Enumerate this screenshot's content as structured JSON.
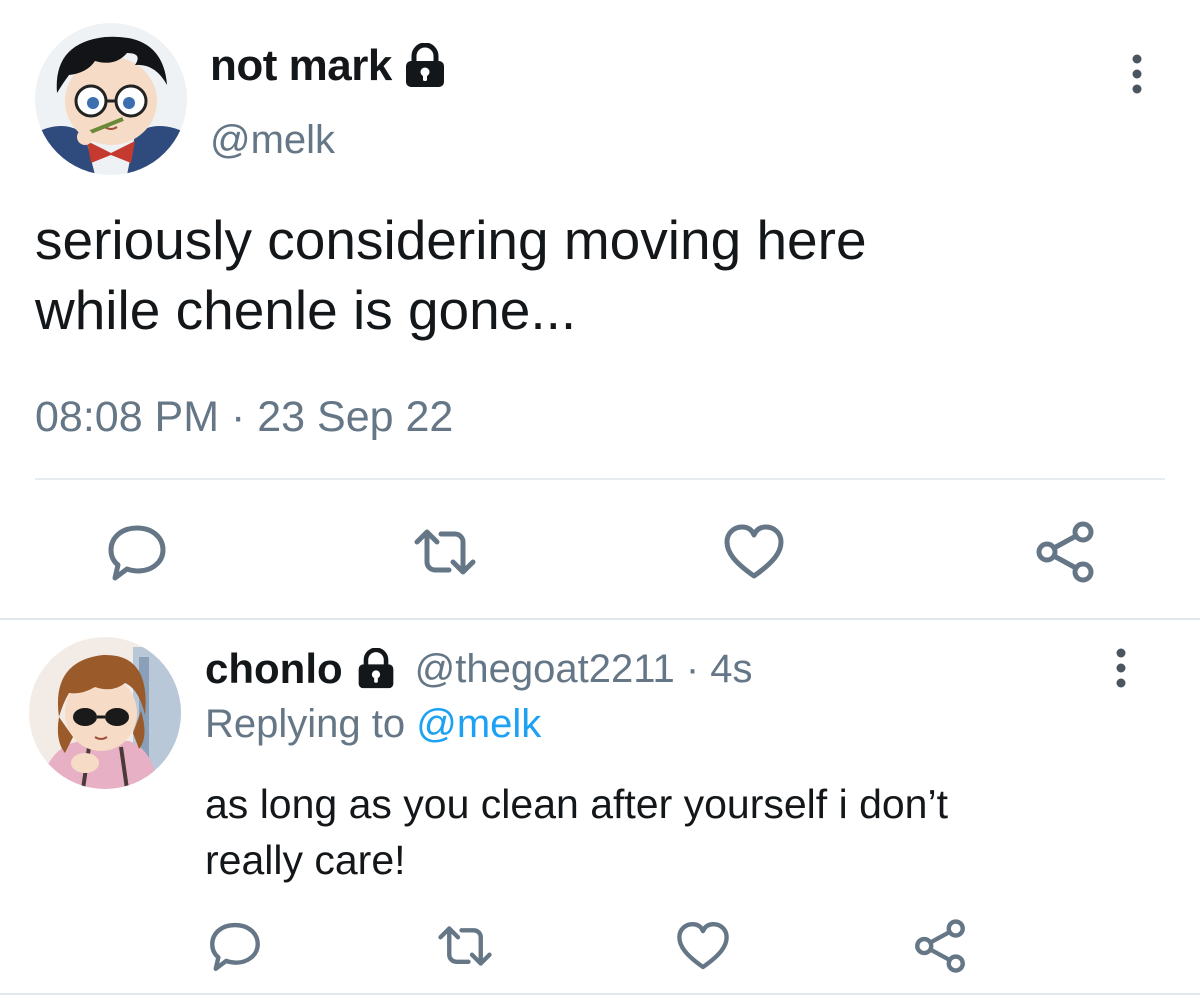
{
  "tweet": {
    "display_name": "not mark",
    "handle": "@melk",
    "text_line1": "seriously considering moving here",
    "text_line2": "while chenle is gone...",
    "timestamp": "08:08 PM · 23 Sep 22",
    "avatar_icon": "anime-boy-glasses-avatar",
    "protected_icon": "lock-icon"
  },
  "reply": {
    "display_name": "chonlo",
    "handle": "@thegoat2211 · 4s",
    "replying_prefix": "Replying to",
    "replying_mention": "@melk",
    "text_line1": "as long as you clean after yourself i don’t",
    "text_line2": "really care!",
    "avatar_icon": "anime-girl-sunglasses-avatar",
    "protected_icon": "lock-icon"
  },
  "actions": [
    "reply-icon",
    "retweet-icon",
    "like-icon",
    "share-icon"
  ],
  "colors": {
    "text": "#14171a",
    "secondary": "#657786",
    "mention": "#1da1f2",
    "divider": "#e6ecf0"
  }
}
